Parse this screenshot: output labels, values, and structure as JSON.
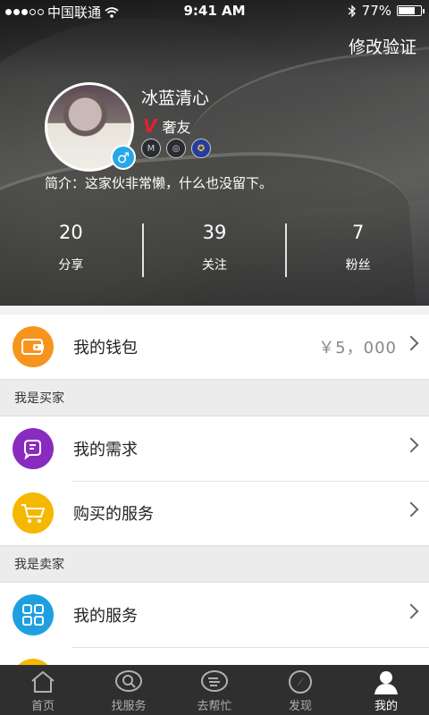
{
  "status_bar": {
    "carrier": "中国联通",
    "time": "9:41 AM",
    "battery": "77%",
    "battery_level": 0.77
  },
  "header": {
    "action": "修改验证",
    "username": "冰蓝清心",
    "vip_label": "奢友",
    "gender_icon": "male-icon",
    "intro": "简介：这家伙非常懒，什么也没留下。"
  },
  "stats": [
    {
      "value": "20",
      "label": "分享"
    },
    {
      "value": "39",
      "label": "关注"
    },
    {
      "value": "7",
      "label": "粉丝"
    }
  ],
  "wallet": {
    "label": "我的钱包",
    "amount": "￥5，000"
  },
  "buyer": {
    "title": "我是买家",
    "items": [
      {
        "label": "我的需求"
      },
      {
        "label": "购买的服务"
      }
    ]
  },
  "seller": {
    "title": "我是卖家",
    "items": [
      {
        "label": "我的服务"
      }
    ]
  },
  "colors": {
    "wallet": "#f7941d",
    "demand": "#8a2bbf",
    "purchased": "#f5b800",
    "service": "#1ea0e0",
    "tabbar": "#2f2f30"
  },
  "tabs": [
    {
      "label": "首页",
      "icon": "home-icon"
    },
    {
      "label": "找服务",
      "icon": "search-service-icon"
    },
    {
      "label": "去帮忙",
      "icon": "help-hand-icon"
    },
    {
      "label": "发现",
      "icon": "compass-icon"
    },
    {
      "label": "我的",
      "icon": "user-icon",
      "active": true
    }
  ]
}
